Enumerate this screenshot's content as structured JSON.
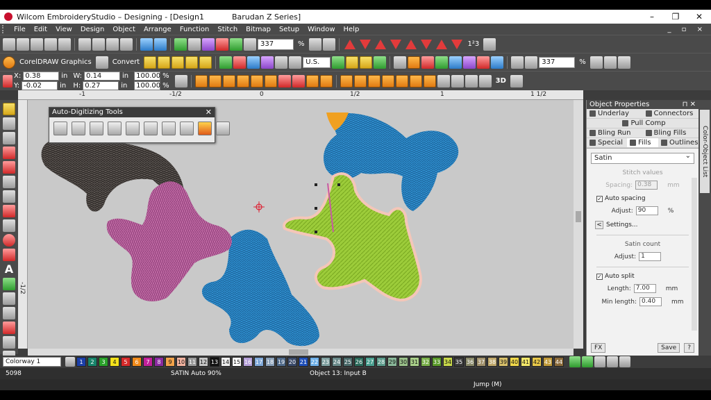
{
  "titlebar": {
    "app_title": "Wilcom EmbroideryStudio – Designing - [Design1",
    "machine": "Barudan Z Series]",
    "minimize": "–",
    "restore": "❐",
    "close": "✕"
  },
  "menu": {
    "items": [
      "File",
      "Edit",
      "View",
      "Design",
      "Object",
      "Arrange",
      "Function",
      "Stitch",
      "Bitmap",
      "Setup",
      "Window",
      "Help"
    ],
    "mdi_controls": "_ ▫ ×"
  },
  "toolbar1": {
    "zoom_value": "337",
    "zoom_unit": "%"
  },
  "toolbar2": {
    "corel_label": "CorelDRAW Graphics",
    "convert_label": "Convert",
    "units": "U.S.",
    "zoom_value": "337",
    "zoom_unit": "%"
  },
  "toolbar3": {
    "x_label": "X:",
    "x_value": "0.38",
    "x_unit": "in",
    "y_label": "Y:",
    "y_value": "-0.02",
    "y_unit": "in",
    "w_label": "W:",
    "w_value": "0.14",
    "w_unit": "in",
    "h_label": "H:",
    "h_value": "0.27",
    "h_unit": "in",
    "sx_value": "100.00",
    "sx_unit": "%",
    "sy_value": "100.00",
    "sy_unit": "%",
    "three_d": "3D"
  },
  "ruler": {
    "ticks": [
      "-1",
      "-1/2",
      "0",
      "1/2",
      "1",
      "1 1/2"
    ],
    "left_tick": "-1/2"
  },
  "auto_digitizing": {
    "title": "Auto-Digitizing Tools",
    "close": "✕"
  },
  "object_properties": {
    "title": "Object Properties",
    "pin": "⊓ ✕",
    "tabs": {
      "underlay": "Underlay",
      "connectors": "Connectors",
      "pull_comp": "Pull Comp",
      "bling_run": "Bling Run",
      "bling_fills": "Bling Fills",
      "special": "Special",
      "fills": "Fills",
      "outlines": "Outlines"
    },
    "fill_type": "Satin",
    "stitch_values": "Stitch values",
    "spacing_label": "Spacing:",
    "spacing_value": "0.38",
    "spacing_unit": "mm",
    "auto_spacing": "Auto spacing",
    "auto_spacing_checked": "✓",
    "adjust_label": "Adjust:",
    "adjust_value": "90",
    "adjust_unit": "%",
    "settings": "Settings...",
    "satin_count": "Satin count",
    "adjust2_label": "Adjust:",
    "adjust2_value": "1",
    "auto_split": "Auto split",
    "auto_split_checked": "✓",
    "length_label": "Length:",
    "length_value": "7.00",
    "length_unit": "mm",
    "min_length_label": "Min length:",
    "min_length_value": "0.40",
    "min_length_unit": "mm",
    "fx": "FX",
    "save": "Save",
    "help": "?"
  },
  "side_tab": {
    "label": "Color-Object List"
  },
  "palette": {
    "colorway": "Colorway 1",
    "swatches": [
      {
        "n": "1",
        "c": "#1b3fa8"
      },
      {
        "n": "2",
        "c": "#17846a"
      },
      {
        "n": "3",
        "c": "#2aa12a"
      },
      {
        "n": "4",
        "c": "#f4e21b"
      },
      {
        "n": "5",
        "c": "#d62a2a"
      },
      {
        "n": "6",
        "c": "#f08a1a"
      },
      {
        "n": "7",
        "c": "#c2209a"
      },
      {
        "n": "8",
        "c": "#8a2aa0"
      },
      {
        "n": "9",
        "c": "#f2a24a"
      },
      {
        "n": "10",
        "c": "#f2b3a0"
      },
      {
        "n": "11",
        "c": "#9a9a9a"
      },
      {
        "n": "12",
        "c": "#c7c7c7"
      },
      {
        "n": "13",
        "c": "#111111"
      },
      {
        "n": "14",
        "c": "#eeeeee"
      },
      {
        "n": "15",
        "c": "#ffffff"
      },
      {
        "n": "16",
        "c": "#b5a0d8"
      },
      {
        "n": "17",
        "c": "#7fa8d8"
      },
      {
        "n": "18",
        "c": "#8aa0b8"
      },
      {
        "n": "19",
        "c": "#506a8a"
      },
      {
        "n": "20",
        "c": "#3a4a6a"
      },
      {
        "n": "21",
        "c": "#1f4fb8"
      },
      {
        "n": "22",
        "c": "#6fb0e8"
      },
      {
        "n": "23",
        "c": "#7fa0a0"
      },
      {
        "n": "24",
        "c": "#6a8a8a"
      },
      {
        "n": "25",
        "c": "#4a6a6a"
      },
      {
        "n": "26",
        "c": "#2a6a5a"
      },
      {
        "n": "27",
        "c": "#4aa090"
      },
      {
        "n": "28",
        "c": "#5a9a8a"
      },
      {
        "n": "29",
        "c": "#8ab89a"
      },
      {
        "n": "30",
        "c": "#9ac08a"
      },
      {
        "n": "31",
        "c": "#aad08a"
      },
      {
        "n": "32",
        "c": "#7ab04a"
      },
      {
        "n": "33",
        "c": "#5a9a2a"
      },
      {
        "n": "34",
        "c": "#c8d84a"
      },
      {
        "n": "35",
        "c": "#3a3a3a"
      },
      {
        "n": "36",
        "c": "#8a8a6a"
      },
      {
        "n": "37",
        "c": "#a0906a"
      },
      {
        "n": "38",
        "c": "#c0a86a"
      },
      {
        "n": "39",
        "c": "#d8c06a"
      },
      {
        "n": "40",
        "c": "#f0d84a"
      },
      {
        "n": "41",
        "c": "#f4e86a"
      },
      {
        "n": "42",
        "c": "#e8c84a"
      },
      {
        "n": "43",
        "c": "#c09a3a"
      },
      {
        "n": "44",
        "c": "#8a6a3a"
      }
    ]
  },
  "status": {
    "count": "5098",
    "stitch": "SATIN Auto 90%",
    "object": "Object 13: Input B",
    "mode": "Jump (M)"
  }
}
